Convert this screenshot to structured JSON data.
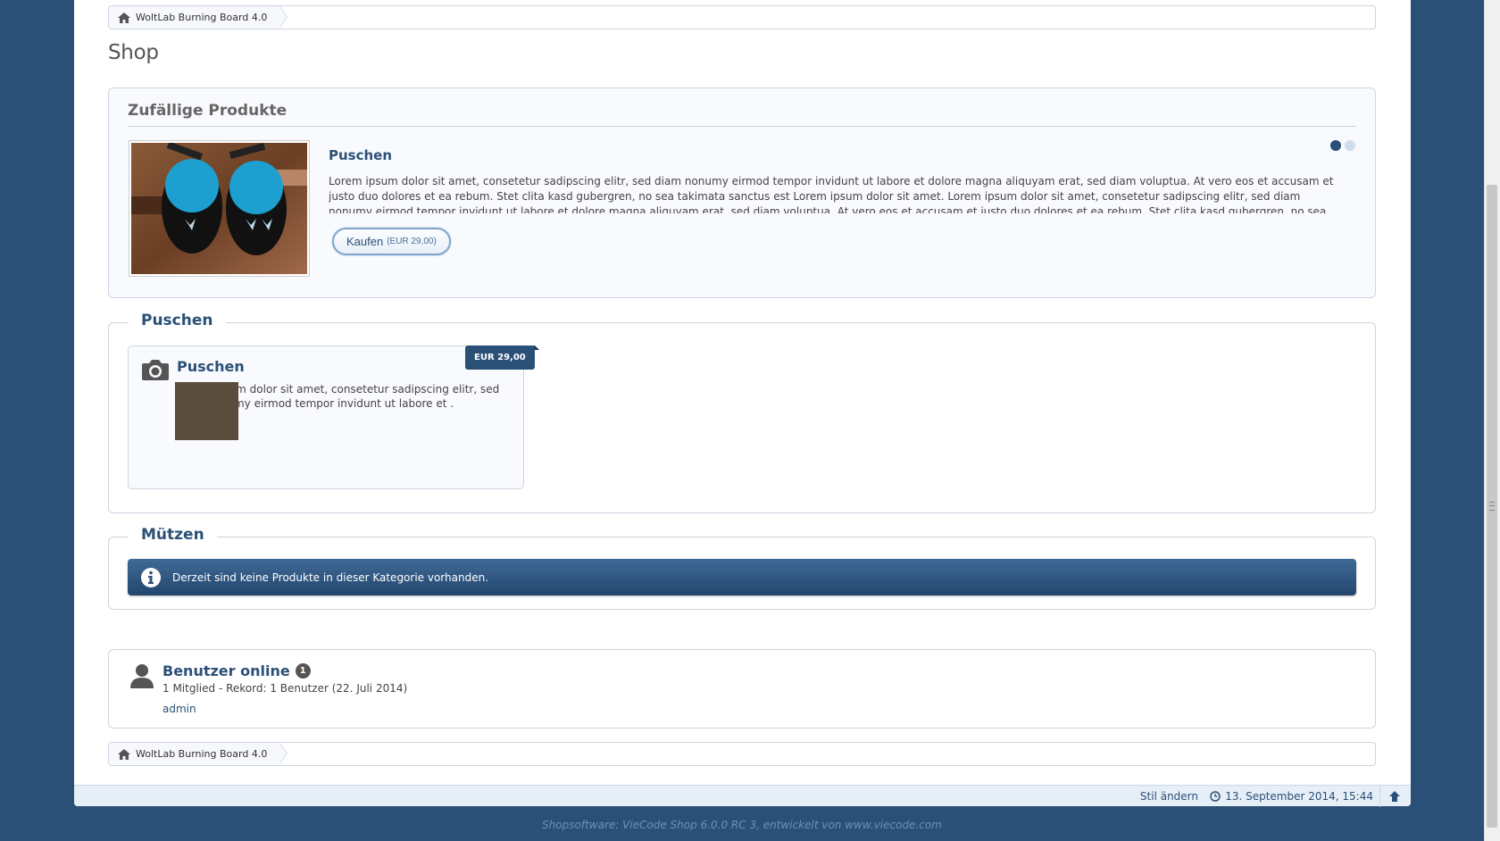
{
  "breadcrumb": {
    "home_label": "WoltLab Burning Board 4.0"
  },
  "page": {
    "title": "Shop"
  },
  "random_products": {
    "title": "Zufällige Produkte",
    "product": {
      "name": "Puschen",
      "description": "Lorem ipsum dolor sit amet, consetetur sadipscing elitr, sed diam nonumy eirmod tempor invidunt ut labore et dolore magna aliquyam erat, sed diam voluptua. At vero eos et accusam et justo duo dolores et ea rebum. Stet clita kasd gubergren, no sea takimata sanctus est Lorem ipsum dolor sit amet. Lorem ipsum dolor sit amet, consetetur sadipscing elitr, sed diam nonumy eirmod tempor invidunt ut labore et dolore magna aliquyam erat, sed diam voluptua. At vero eos et accusam et justo duo dolores et ea rebum. Stet clita kasd gubergren, no sea takimata sanctus est",
      "buy_label": "Kaufen",
      "buy_price": "(EUR 29,00)"
    },
    "slider_pages": 2,
    "slider_active": 1
  },
  "categories": [
    {
      "name": "Puschen",
      "products": [
        {
          "name": "Puschen",
          "price": "EUR 29,00",
          "description": "Lorem ipsum dolor sit amet, consetetur sadipscing elitr, sed diam nonumy eirmod tempor invidunt ut labore et ."
        }
      ]
    },
    {
      "name": "Mützen",
      "empty_message": "Derzeit sind keine Produkte in dieser Kategorie vorhanden."
    }
  ],
  "users_online": {
    "title": "Benutzer online",
    "count": "1",
    "record": "1 Mitglied - Rekord: 1 Benutzer (22. Juli 2014)",
    "users": [
      "admin"
    ]
  },
  "footer": {
    "style_link": "Stil ändern",
    "datetime": "13. September 2014, 15:44"
  },
  "copyright": "Shopsoftware: VieCode Shop 6.0.0 RC 3, entwickelt von www.viecode.com",
  "colors": {
    "background": "#2b5077",
    "accent": "#2b5077",
    "info_bar": "#2f5882"
  }
}
